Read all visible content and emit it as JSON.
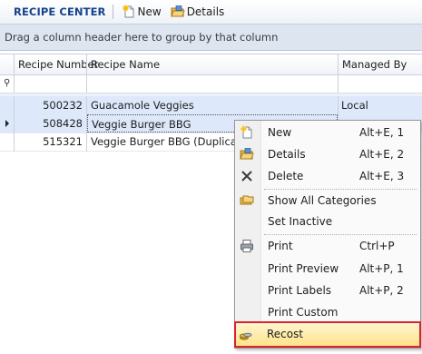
{
  "toolbar": {
    "title": "RECIPE CENTER",
    "new_label": "New",
    "details_label": "Details"
  },
  "group_panel": {
    "text": "Drag a column header here to group by that column"
  },
  "grid": {
    "columns": [
      "Recipe Number",
      "Recipe Name",
      "Managed By"
    ],
    "rows": [
      {
        "number": "500232",
        "name": "Guacamole Veggies",
        "managed_by": "Local"
      },
      {
        "number": "508428",
        "name": "Veggie Burger BBG",
        "managed_by": ""
      },
      {
        "number": "515321",
        "name": "Veggie Burger BBG  (Duplicate)",
        "managed_by": ""
      }
    ]
  },
  "context_menu": {
    "items": [
      {
        "label": "New",
        "shortcut": "Alt+E, 1",
        "icon": "new-doc-icon"
      },
      {
        "label": "Details",
        "shortcut": "Alt+E, 2",
        "icon": "folder-open-icon"
      },
      {
        "label": "Delete",
        "shortcut": "Alt+E, 3",
        "icon": "delete-x-icon"
      },
      {
        "label": "Show All Categories",
        "shortcut": "",
        "icon": "categories-icon"
      },
      {
        "label": "Set Inactive",
        "shortcut": "",
        "icon": ""
      },
      {
        "label": "Print",
        "shortcut": "Ctrl+P",
        "icon": "printer-icon"
      },
      {
        "label": "Print Preview",
        "shortcut": "Alt+P, 1",
        "icon": ""
      },
      {
        "label": "Print Labels",
        "shortcut": "Alt+P, 2",
        "icon": ""
      },
      {
        "label": "Print Custom",
        "shortcut": "",
        "icon": ""
      },
      {
        "label": "Recost",
        "shortcut": "",
        "icon": "coins-icon"
      }
    ],
    "highlighted_item": "Recost"
  },
  "colors": {
    "highlight_outline": "#d9232e",
    "highlight_fill": "#ffe38a",
    "title_blue": "#15428b",
    "selection_blue": "#dde8fb"
  }
}
